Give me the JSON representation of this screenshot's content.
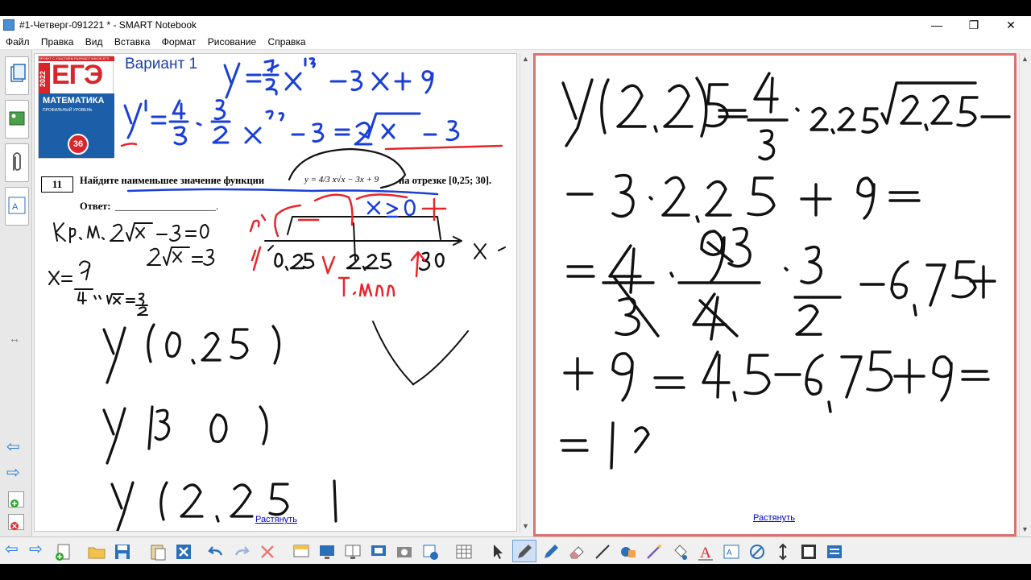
{
  "window": {
    "title": "#1-Четверг-091221 * - SMART Notebook",
    "minimize": "—",
    "restore": "❐",
    "close": "✕"
  },
  "menu": [
    "Файл",
    "Правка",
    "Вид",
    "Вставка",
    "Формат",
    "Рисование",
    "Справка"
  ],
  "left_page": {
    "book": {
      "top_line": "ПРОЕКТ С УЧАСТИЕМ РАЗРАБОТЧИКОВ ЕГЭ",
      "year": "2022",
      "exam": "ЕГЭ",
      "subject": "МАТЕМАТИКА",
      "subtitle": "ПРОФИЛЬНЫЙ УРОВЕНЬ",
      "badge": "36"
    },
    "variant": "Вариант 1",
    "task_number": "11",
    "task_text": "Найдите наименьшее значение функции",
    "task_formula": "y = 4/3 x√x − 3x + 9",
    "task_interval": "на отрезке [0,25; 30].",
    "answer_label": "Ответ:",
    "answer_blank": "____________________.",
    "stretch_link": "Растянуть"
  },
  "right_page": {
    "stretch_link": "Растянуть"
  },
  "colors": {
    "ink_blue": "#1a3fd6",
    "ink_red": "#e8252a",
    "ink_black": "#111111",
    "frame_red": "#e07070",
    "ege_red": "#d8262c",
    "ege_blue": "#1c5fa8"
  }
}
